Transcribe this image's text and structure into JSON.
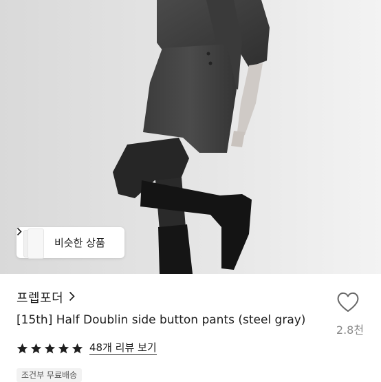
{
  "similar_button": {
    "label": "비슷한 상품"
  },
  "shop": {
    "name": "프렙포더"
  },
  "product": {
    "title": "[15th] Half Doublin side button pants (steel gray)"
  },
  "likes": {
    "count": "2.8천"
  },
  "rating": {
    "stars": 5,
    "review_label": "48개 리뷰 보기"
  },
  "shipping": {
    "badge": "조건부 무료배송"
  },
  "icons": {
    "heart": "heart-outline-icon",
    "shop_chevron": "chevron-right-icon",
    "similar_chevron": "chevron-right-icon",
    "star": "star-filled-icon"
  },
  "colors": {
    "text": "#1e1e1e",
    "muted": "#8a8a8a",
    "badge_bg": "#f2f2f2"
  }
}
